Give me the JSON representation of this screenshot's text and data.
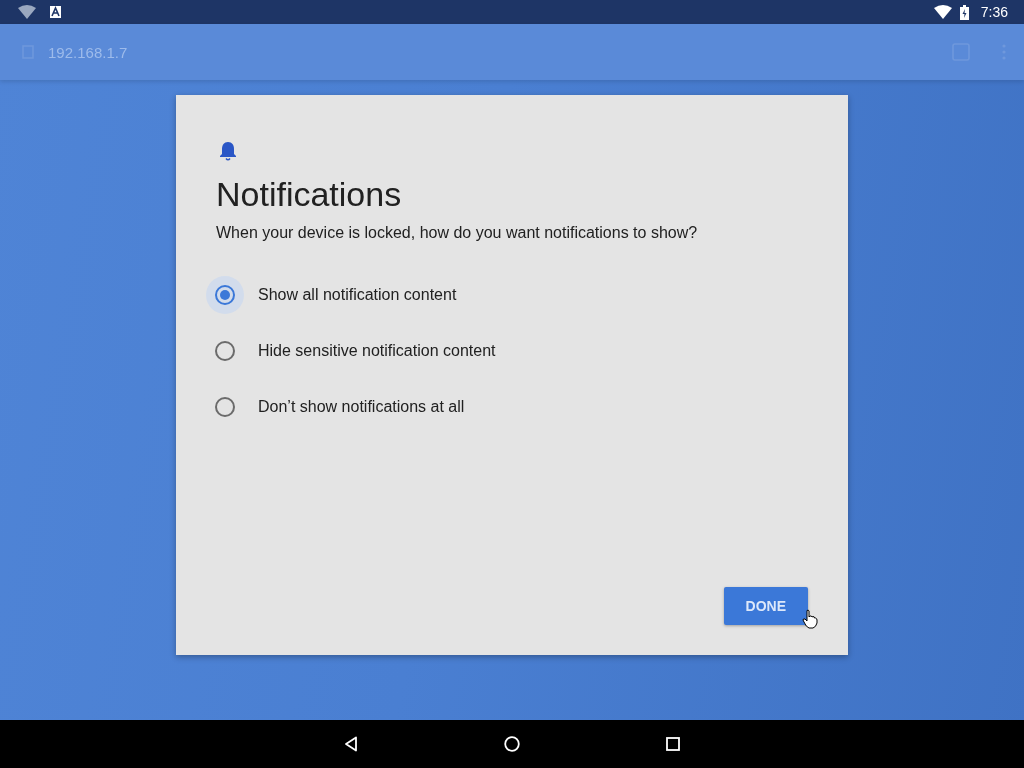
{
  "status_bar": {
    "time": "7:36"
  },
  "top_bar": {
    "address": "192.168.1.7"
  },
  "dialog": {
    "title": "Notifications",
    "question": "When your device is locked, how do you want notifications to show?",
    "options": [
      {
        "label": "Show all notification content",
        "selected": true
      },
      {
        "label": "Hide sensitive notification content",
        "selected": false
      },
      {
        "label": "Don’t show notifications at all",
        "selected": false
      }
    ],
    "button": "DONE"
  }
}
